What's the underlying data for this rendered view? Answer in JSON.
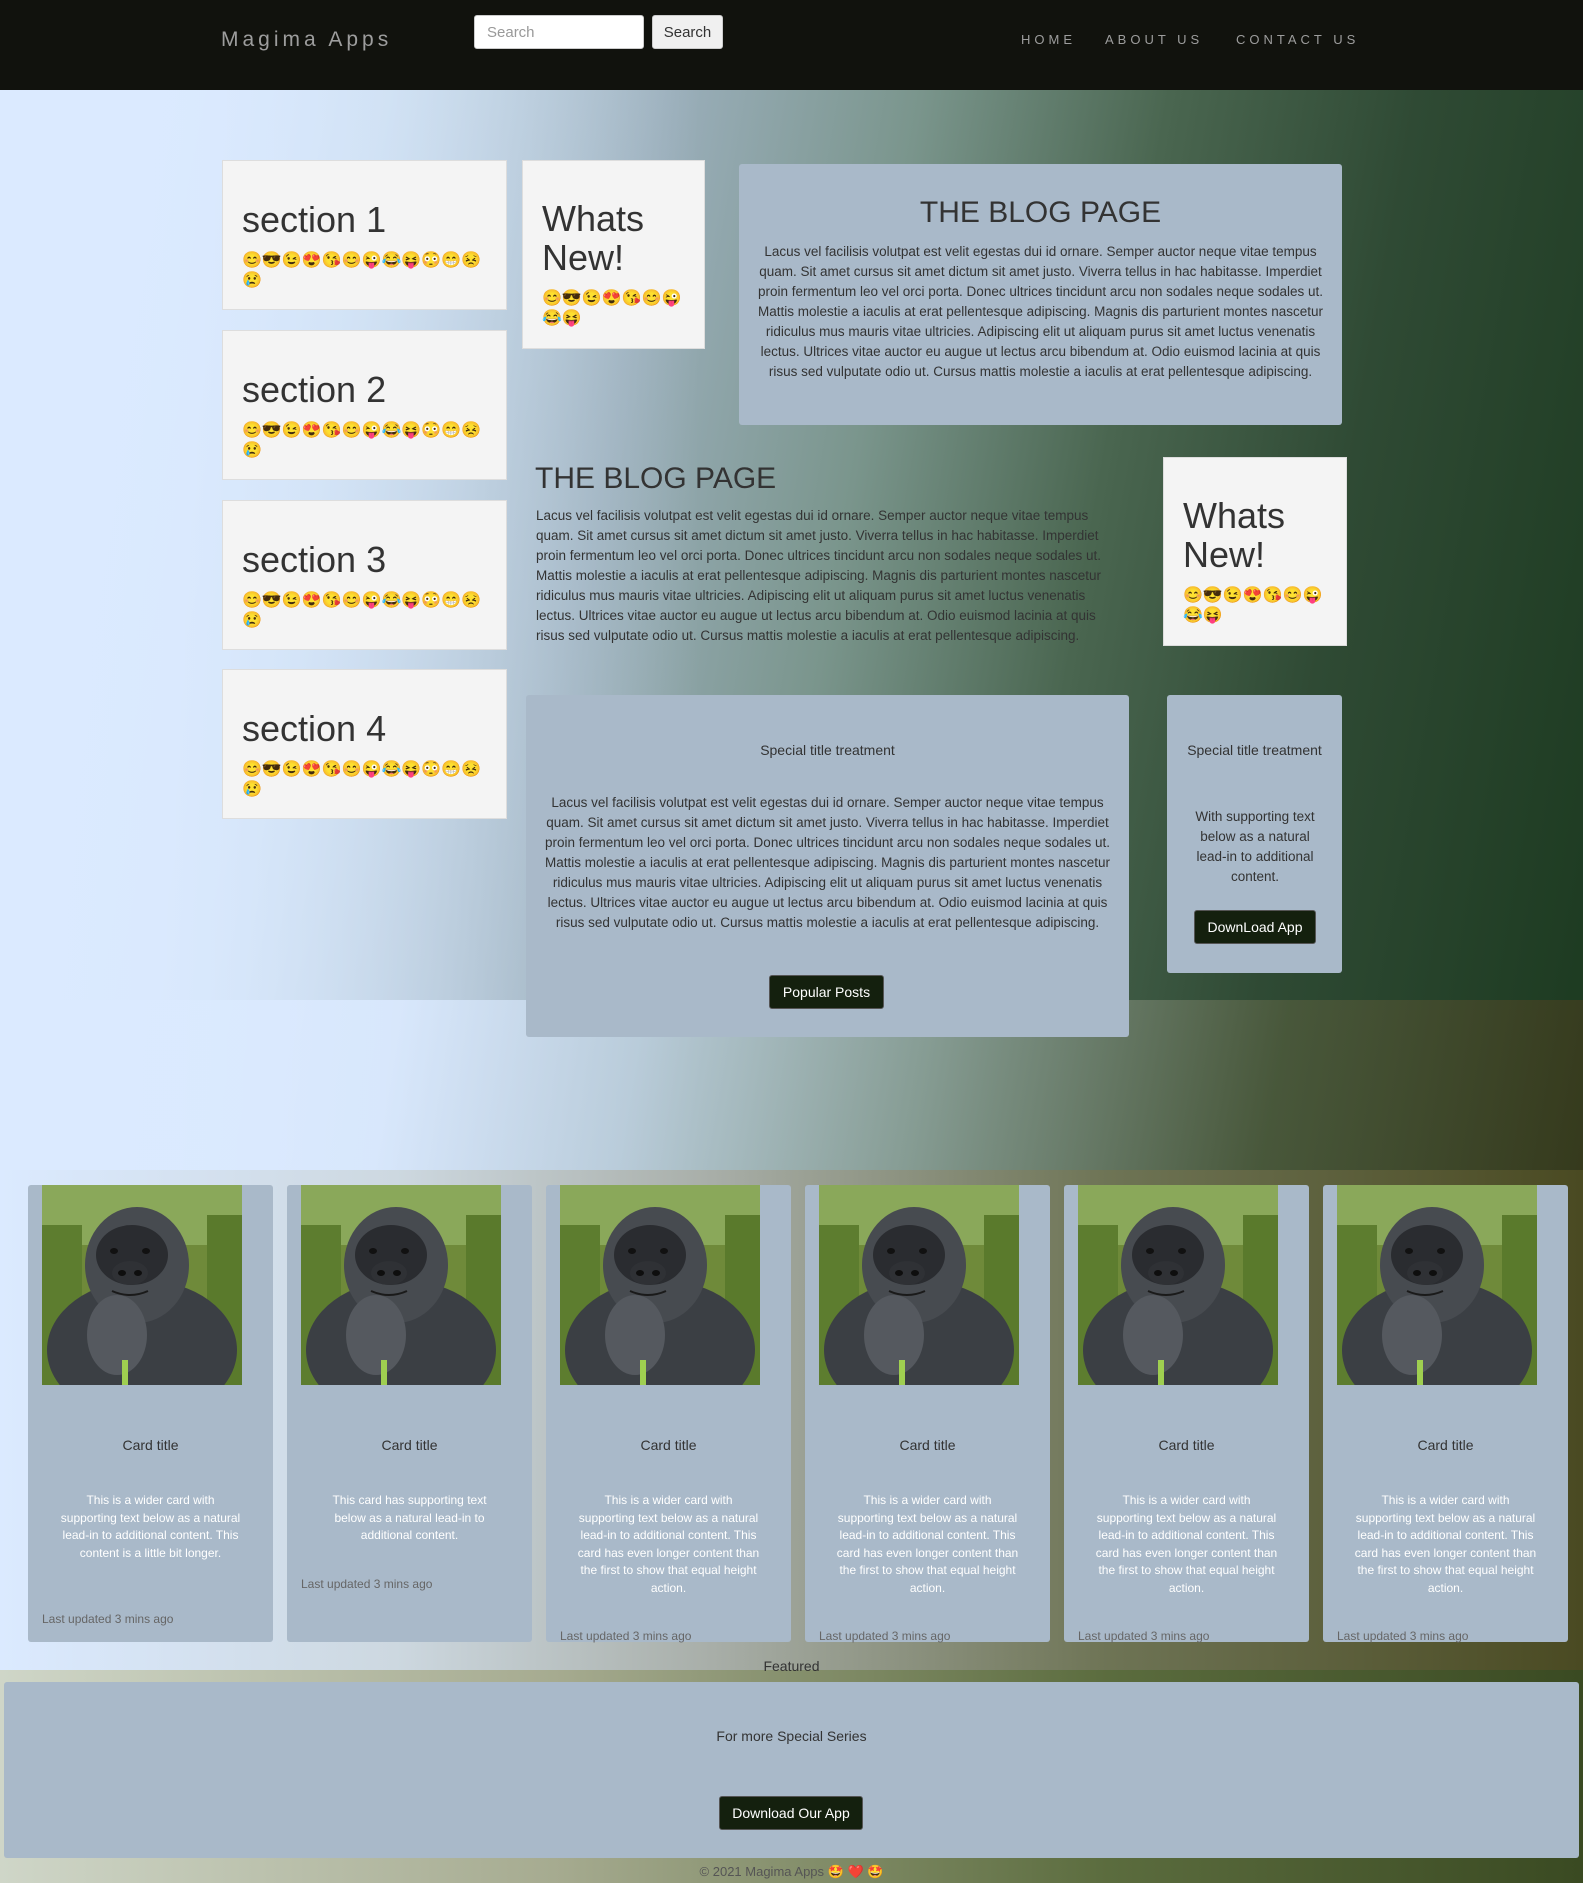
{
  "nav": {
    "brand": "Magima Apps",
    "search_placeholder": "Search",
    "search_button": "Search",
    "links": [
      "HOME",
      "ABOUT US",
      "CONTACT US"
    ]
  },
  "sections": [
    {
      "title": "section 1",
      "emojis": "😊😎😉😍😘😊😜😂😝😳😁😣😢"
    },
    {
      "title": "section 2",
      "emojis": "😊😎😉😍😘😊😜😂😝😳😁😣😢"
    },
    {
      "title": "section 3",
      "emojis": "😊😎😉😍😘😊😜😂😝😳😁😣😢"
    },
    {
      "title": "section 4",
      "emojis": "😊😎😉😍😘😊😜😂😝😳😁😣😢"
    }
  ],
  "whats_new": [
    {
      "title": "Whats New!",
      "emojis": "😊😎😉😍😘😊😜😂😝"
    },
    {
      "title": "Whats New!",
      "emojis": "😊😎😉😍😘😊😜😂😝"
    }
  ],
  "blog_box": {
    "title": "THE BLOG PAGE",
    "text": "Lacus vel facilisis volutpat est velit egestas dui id ornare. Semper auctor neque vitae tempus quam. Sit amet cursus sit amet dictum sit amet justo. Viverra tellus in hac habitasse. Imperdiet proin fermentum leo vel orci porta. Donec ultrices tincidunt arcu non sodales neque sodales ut. Mattis molestie a iaculis at erat pellentesque adipiscing. Magnis dis parturient montes nascetur ridiculus mus mauris vitae ultricies. Adipiscing elit ut aliquam purus sit amet luctus venenatis lectus. Ultrices vitae auctor eu augue ut lectus arcu bibendum at. Odio euismod lacinia at quis risus sed vulputate odio ut. Cursus mattis molestie a iaculis at erat pellentesque adipiscing."
  },
  "blog_plain": {
    "title": "THE BLOG PAGE",
    "text": "Lacus vel facilisis volutpat est velit egestas dui id ornare. Semper auctor neque vitae tempus quam. Sit amet cursus sit amet dictum sit amet justo. Viverra tellus in hac habitasse. Imperdiet proin fermentum leo vel orci porta. Donec ultrices tincidunt arcu non sodales neque sodales ut. Mattis molestie a iaculis at erat pellentesque adipiscing. Magnis dis parturient montes nascetur ridiculus mus mauris vitae ultricies. Adipiscing elit ut aliquam purus sit amet luctus venenatis lectus. Ultrices vitae auctor eu augue ut lectus arcu bibendum at. Odio euismod lacinia at quis risus sed vulputate odio ut. Cursus mattis molestie a iaculis at erat pellentesque adipiscing."
  },
  "special_main": {
    "title": "Special title treatment",
    "text": "Lacus vel facilisis volutpat est velit egestas dui id ornare. Semper auctor neque vitae tempus quam. Sit amet cursus sit amet dictum sit amet justo. Viverra tellus in hac habitasse. Imperdiet proin fermentum leo vel orci porta. Donec ultrices tincidunt arcu non sodales neque sodales ut. Mattis molestie a iaculis at erat pellentesque adipiscing. Magnis dis parturient montes nascetur ridiculus mus mauris vitae ultricies. Adipiscing elit ut aliquam purus sit amet luctus venenatis lectus. Ultrices vitae auctor eu augue ut lectus arcu bibendum at. Odio euismod lacinia at quis risus sed vulputate odio ut. Cursus mattis molestie a iaculis at erat pellentesque adipiscing.",
    "button": "Popular Posts"
  },
  "special_side": {
    "title": "Special title treatment",
    "text": "With supporting text below as a natural lead-in to additional content.",
    "button": "DownLoad App"
  },
  "cards": [
    {
      "title": "Card title",
      "text": "This is a wider card with supporting text below as a natural lead-in to additional content. This content is a little bit longer.",
      "meta": "Last updated 3 mins ago"
    },
    {
      "title": "Card title",
      "text": "This card has supporting text below as a natural lead-in to additional content.",
      "meta": "Last updated 3 mins ago"
    },
    {
      "title": "Card title",
      "text": "This is a wider card with supporting text below as a natural lead-in to additional content. This card has even longer content than the first to show that equal height action.",
      "meta": "Last updated 3 mins ago"
    },
    {
      "title": "Card title",
      "text": "This is a wider card with supporting text below as a natural lead-in to additional content. This card has even longer content than the first to show that equal height action.",
      "meta": "Last updated 3 mins ago"
    },
    {
      "title": "Card title",
      "text": "This is a wider card with supporting text below as a natural lead-in to additional content. This card has even longer content than the first to show that equal height action.",
      "meta": "Last updated 3 mins ago"
    },
    {
      "title": "Card title",
      "text": "This is a wider card with supporting text below as a natural lead-in to additional content. This card has even longer content than the first to show that equal height action.",
      "meta": "Last updated 3 mins ago"
    }
  ],
  "featured": {
    "label": "Featured",
    "title": "For more Special Series",
    "button": "Download Our App"
  },
  "footer": {
    "copyright": "© 2021 Magima Apps 🤩 ❤️ 🤩"
  },
  "colors": {
    "navbar": "#11120d",
    "panel": "#a9b9c9",
    "dark_button": "#14200e"
  }
}
